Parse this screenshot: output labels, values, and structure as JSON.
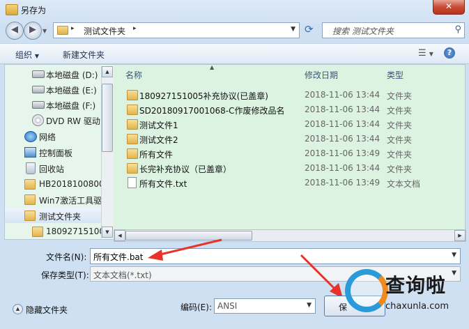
{
  "window": {
    "title": "另存为",
    "close_glyph": "✕"
  },
  "address": {
    "path": "测试文件夹",
    "search_placeholder": "搜索 测试文件夹"
  },
  "toolbar": {
    "organize": "组织",
    "new_folder": "新建文件夹"
  },
  "nav": {
    "items": [
      {
        "label": "本地磁盘 (D:)",
        "icon": "drive-icon"
      },
      {
        "label": "本地磁盘 (E:)",
        "icon": "drive-icon"
      },
      {
        "label": "本地磁盘 (F:)",
        "icon": "drive-icon"
      },
      {
        "label": "DVD RW 驱动",
        "icon": "dvd-icon"
      },
      {
        "label": "网络",
        "icon": "network-icon"
      },
      {
        "label": "控制面板",
        "icon": "control-panel-icon"
      },
      {
        "label": "回收站",
        "icon": "recycle-bin-icon"
      },
      {
        "label": "HB2018100800",
        "icon": "folder-icon"
      },
      {
        "label": "Win7激活工具驱",
        "icon": "folder-icon"
      },
      {
        "label": "测试文件夹",
        "icon": "folder-icon",
        "selected": true
      },
      {
        "label": "18092715100",
        "icon": "folder-icon"
      }
    ]
  },
  "files": {
    "headers": {
      "name": "名称",
      "date": "修改日期",
      "type": "类型"
    },
    "rows": [
      {
        "name": "180927151005补充协议(已盖章)",
        "date": "2018-11-06 13:44",
        "type": "文件夹",
        "icon": "folder-icon"
      },
      {
        "name": "SD20180917001068-C作废修改品名",
        "date": "2018-11-06 13:44",
        "type": "文件夹",
        "icon": "folder-icon"
      },
      {
        "name": "测试文件1",
        "date": "2018-11-06 13:44",
        "type": "文件夹",
        "icon": "folder-icon"
      },
      {
        "name": "测试文件2",
        "date": "2018-11-06 13:44",
        "type": "文件夹",
        "icon": "folder-icon"
      },
      {
        "name": "所有文件",
        "date": "2018-11-06 13:49",
        "type": "文件夹",
        "icon": "folder-icon"
      },
      {
        "name": "长完补充协议（已盖章）",
        "date": "2018-11-06 13:44",
        "type": "文件夹",
        "icon": "folder-icon"
      },
      {
        "name": "所有文件.txt",
        "date": "2018-11-06 13:49",
        "type": "文本文档",
        "icon": "text-file-icon"
      }
    ]
  },
  "form": {
    "filename_label": "文件名(N):",
    "filename_value": "所有文件.bat",
    "filetype_label": "保存类型(T):",
    "filetype_value": "文本文档(*.txt)",
    "hide_folders": "隐藏文件夹",
    "encoding_label": "编码(E):",
    "encoding_value": "ANSI",
    "save_button": "保"
  },
  "colors": {
    "annotation_arrow": "#e8322a",
    "watermark_blue": "#2a9ad8",
    "watermark_orange": "#f08a1a"
  },
  "watermark": {
    "title": "查询啦",
    "url": "chaxunla.com"
  }
}
